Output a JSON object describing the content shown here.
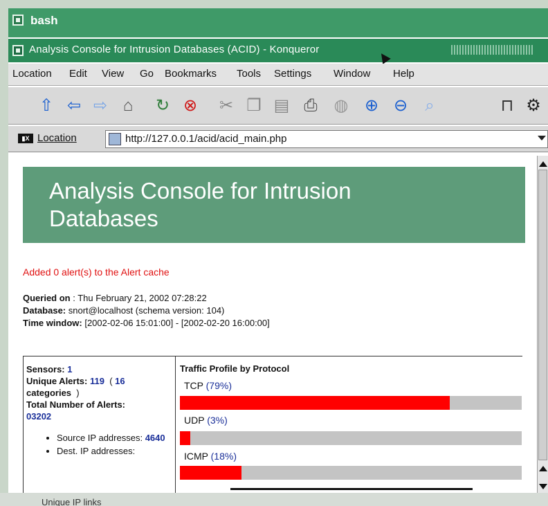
{
  "bash_window": {
    "title": "bash"
  },
  "konqueror": {
    "title": "Analysis Console for Intrusion Databases (ACID)  - Konqueror"
  },
  "menu": {
    "items": [
      "Location",
      "Edit",
      "View",
      "Go",
      "Bookmarks",
      "Tools",
      "Settings",
      "Window",
      "Help"
    ]
  },
  "toolbar": {
    "icons": [
      "up-arrow-icon",
      "back-arrow-icon",
      "forward-arrow-icon",
      "home-icon",
      "reload-icon",
      "stop-icon",
      "cut-icon",
      "copy-icon",
      "paste-icon",
      "print-icon",
      "security-icon",
      "zoom-in-icon",
      "zoom-out-icon",
      "find-icon",
      "lock-icon",
      "settings-gear-icon"
    ]
  },
  "location_bar": {
    "label": "Location",
    "url": "http://127.0.0.1/acid/acid_main.php"
  },
  "page": {
    "banner_line1": "Analysis Console for Intrusion",
    "banner_line2": "Databases",
    "alert_message": "Added 0 alert(s) to the Alert cache",
    "queried_on_label": "Queried on",
    "queried_on_value": " : Thu February 21, 2002 07:28:22",
    "database_label": "Database:",
    "database_value": " snort@localhost   (schema version: 104)",
    "time_window_label": "Time window:",
    "time_window_value": " [2002-02-06 15:01:00] - [2002-02-20 16:00:00]",
    "stats": {
      "sensors_label": "Sensors:",
      "sensors_value": "1",
      "unique_alerts_label": "Unique Alerts:",
      "unique_alerts_value": "119",
      "categories_value": "16",
      "categories_label": "categories",
      "total_label": "Total Number of Alerts:",
      "total_value": "03202",
      "source_ip_label": "Source IP addresses:",
      "source_ip_value": "4640",
      "dest_ip_label": "Dest. IP addresses:",
      "cut_text": "Unique IP links"
    },
    "traffic": {
      "heading": "Traffic Profile by Protocol",
      "protocols": [
        {
          "name": "TCP",
          "percent_label": "(79%)",
          "fraction": 0.79
        },
        {
          "name": "UDP",
          "percent_label": "(3%)",
          "fraction": 0.03
        },
        {
          "name": "ICMP",
          "percent_label": "(18%)",
          "fraction": 0.18
        }
      ]
    }
  },
  "colors": {
    "banner": "#5e9c7a",
    "title_bar": "#2a8a58",
    "alert_text": "#e01010",
    "bar_fill": "#ff0000",
    "bar_track": "#c4c4c4",
    "link_number": "#1a2f99"
  }
}
